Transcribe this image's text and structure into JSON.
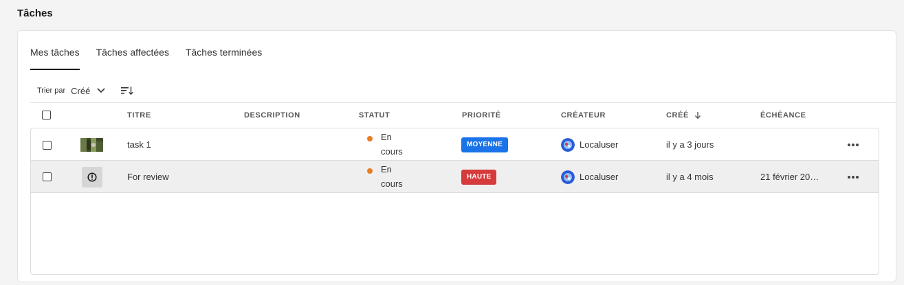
{
  "page": {
    "title": "Tâches"
  },
  "tabs": [
    {
      "label": "Mes tâches",
      "active": true
    },
    {
      "label": "Tâches affectées",
      "active": false
    },
    {
      "label": "Tâches terminées",
      "active": false
    }
  ],
  "sort": {
    "label": "Trier par",
    "value": "Créé"
  },
  "columns": {
    "title": "TITRE",
    "description": "DESCRIPTION",
    "status": "STATUT",
    "priority": "PRIORITÉ",
    "creator": "CRÉATEUR",
    "created": "CRÉÉ",
    "due": "ÉCHÉANCE"
  },
  "rows": [
    {
      "title": "task 1",
      "description": "",
      "status_line1": "En",
      "status_line2": "cours",
      "priority": "MOYENNE",
      "priority_color": "#1a73e8",
      "creator": "Localuser",
      "created": "il y a 3 jours",
      "due": "",
      "thumbnail": "image-thumbnail"
    },
    {
      "title": "For review",
      "description": "",
      "status_line1": "En",
      "status_line2": "cours",
      "priority": "HAUTE",
      "priority_color": "#d63a3a",
      "creator": "Localuser",
      "created": "il y a 4 mois",
      "due": "21 février 20…",
      "thumbnail": "alert-icon"
    }
  ],
  "colors": {
    "status_in_progress": "#e67e22",
    "tab_underline": "#1a1a1a"
  }
}
